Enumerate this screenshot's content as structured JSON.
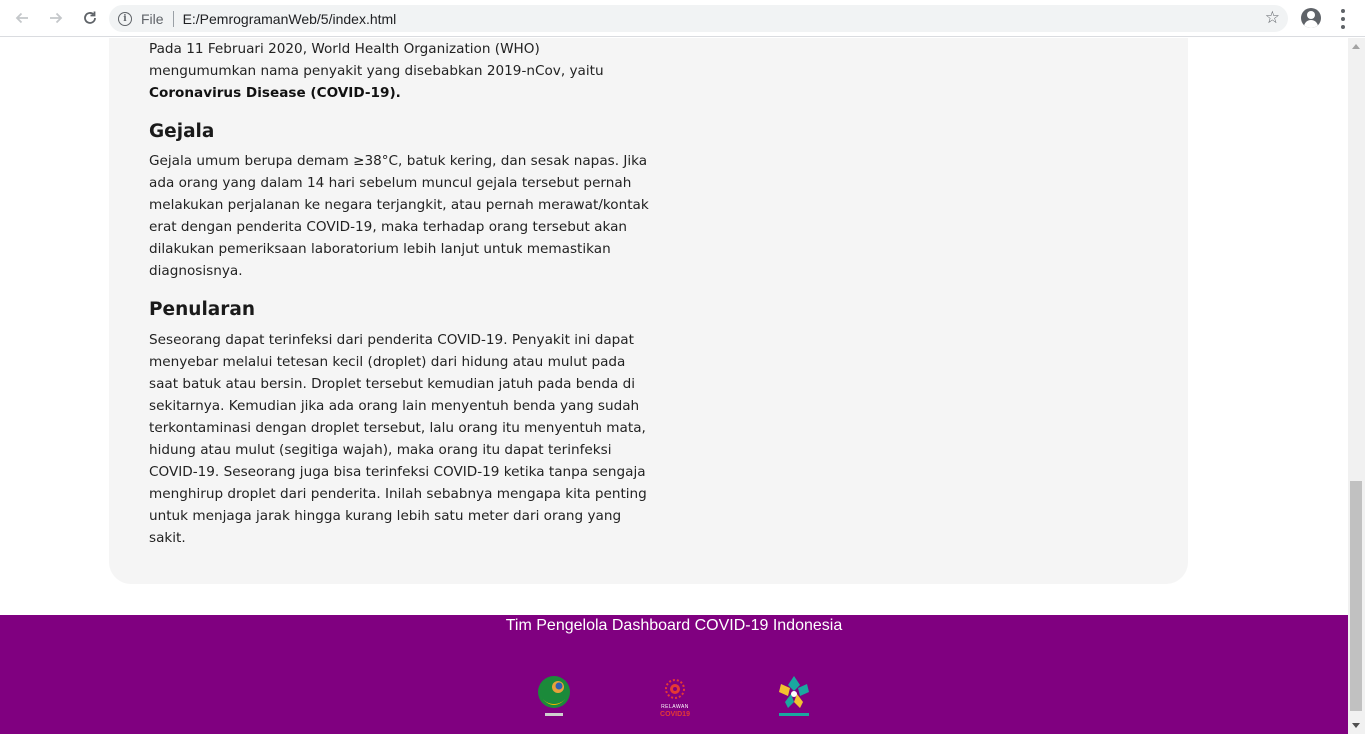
{
  "browser": {
    "url_scheme": "File",
    "url": "E:/PemrogramanWeb/5/index.html",
    "back_icon": "arrow-left-icon",
    "forward_icon": "arrow-right-icon",
    "reload_icon": "reload-icon",
    "info_icon": "info-icon",
    "bookmark_icon": "star-icon",
    "profile_icon": "account-circle-icon",
    "menu_icon": "more-vert-icon"
  },
  "article": {
    "intro_text": "Pada 11 Februari 2020, World Health Organization (WHO) mengumumkan nama penyakit yang disebabkan 2019-nCov, yaitu ",
    "intro_bold": "Coronavirus Disease (COVID-19).",
    "gejala_heading": "Gejala",
    "gejala_text": "Gejala umum berupa demam ≥38°C, batuk kering, dan sesak napas. Jika ada orang yang dalam 14 hari sebelum muncul gejala tersebut pernah melakukan perjalanan ke negara terjangkit, atau pernah merawat/kontak erat dengan penderita COVID-19, maka terhadap orang tersebut akan dilakukan pemeriksaan laboratorium lebih lanjut untuk memastikan diagnosisnya.",
    "penularan_heading": "Penularan",
    "penularan_text": "Seseorang dapat terinfeksi dari penderita COVID-19. Penyakit ini dapat menyebar melalui tetesan kecil (droplet) dari hidung atau mulut pada saat batuk atau bersin. Droplet tersebut kemudian jatuh pada benda di sekitarnya. Kemudian jika ada orang lain menyentuh benda yang sudah terkontaminasi dengan droplet tersebut, lalu orang itu menyentuh mata, hidung atau mulut (segitiga wajah), maka orang itu dapat terinfeksi COVID-19. Seseorang juga bisa terinfeksi COVID-19 ketika tanpa sengaja menghirup droplet dari penderita. Inilah sebabnya mengapa kita penting untuk menjaga jarak hingga kurang lebih satu meter dari orang yang sakit."
  },
  "footer": {
    "title": "Tim Pengelola Dashboard COVID-19 Indonesia",
    "logos": [
      {
        "name": "gugus-tugas-logo"
      },
      {
        "name": "relawan-covid19-logo",
        "text": "RELAWAN COVID19"
      },
      {
        "name": "kemenkes-logo"
      }
    ],
    "background_color": "#800080"
  }
}
